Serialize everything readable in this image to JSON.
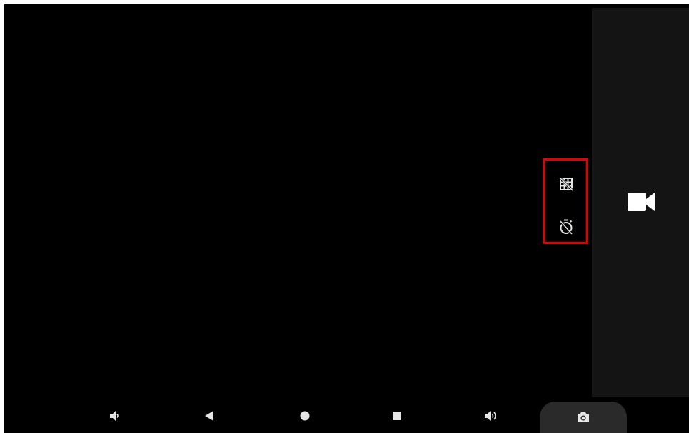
{
  "app": {
    "name": "Camera"
  },
  "colors": {
    "background": "#000000",
    "side_panel": "#141414",
    "icon": "#e6e6e6",
    "highlight_box": "#e00000",
    "shutter_pill": "#2a2a2a"
  },
  "side_panel": {
    "mode_icon": "video-camera-icon"
  },
  "quick_settings": {
    "grid_icon": "grid-off-icon",
    "timer_icon": "timer-off-icon"
  },
  "nav_bar": {
    "items": [
      {
        "icon": "volume-down-icon"
      },
      {
        "icon": "back-icon"
      },
      {
        "icon": "home-icon"
      },
      {
        "icon": "recents-icon"
      },
      {
        "icon": "volume-up-icon"
      },
      {
        "icon": "camera-shutter-icon"
      }
    ]
  }
}
